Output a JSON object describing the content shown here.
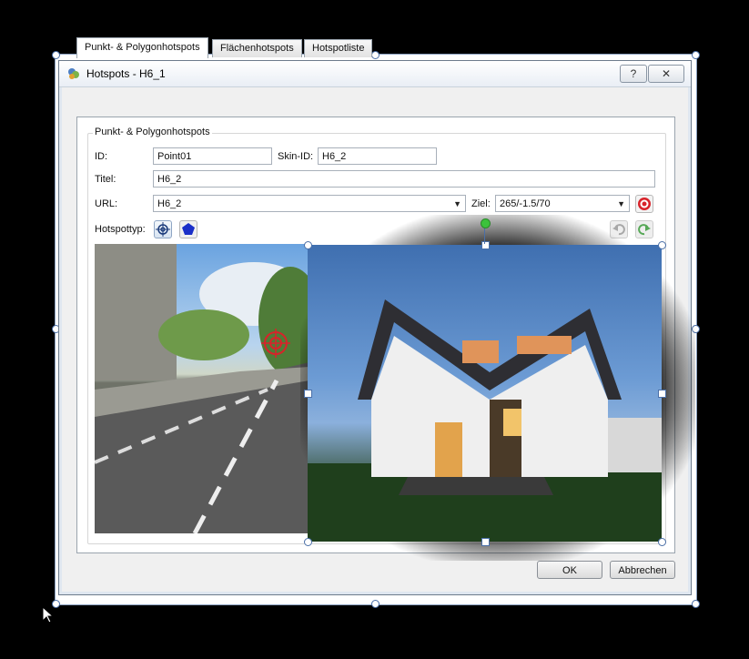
{
  "window": {
    "title": "Hotspots - H6_1",
    "help_label": "?",
    "close_label": "✕"
  },
  "tabs": [
    {
      "label": "Punkt- & Polygonhotspots"
    },
    {
      "label": "Flächenhotspots"
    },
    {
      "label": "Hotspotliste"
    }
  ],
  "group": {
    "title": "Punkt- & Polygonhotspots"
  },
  "form": {
    "id_label": "ID:",
    "id_value": "Point01",
    "skin_id_label": "Skin-ID:",
    "skin_id_value": "H6_2",
    "title_label": "Titel:",
    "title_value": "H6_2",
    "url_label": "URL:",
    "url_value": "H6_2",
    "target_label": "Ziel:",
    "target_value": "265/-1.5/70",
    "hotspot_type_label": "Hotspottyp:"
  },
  "icons": {
    "app": "app-logo-icon",
    "point_type": "crosshair-icon",
    "polygon_type": "pentagon-icon",
    "target": "target-icon",
    "undo": "undo-icon",
    "redo": "redo-icon"
  },
  "colors": {
    "hotspot_marker": "#d8232a",
    "polygon_icon": "#1a2fc8",
    "green_handle": "#3cc23c"
  },
  "buttons": {
    "ok_label": "OK",
    "cancel_label": "Abbrechen"
  }
}
